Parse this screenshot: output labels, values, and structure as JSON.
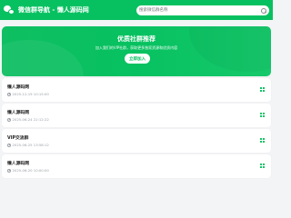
{
  "header": {
    "site_title": "微信群导航 - 懒人源码网",
    "search_placeholder": "搜索微信群名称"
  },
  "banner": {
    "title": "优质社群推荐",
    "description": "加入我们的VIP社群，获取更多独家资源和优质内容",
    "button_label": "立即加入"
  },
  "list": [
    {
      "title": "懒人源码网",
      "time": "2025-12-19 10:15:00"
    },
    {
      "title": "懒人源码网",
      "time": "2025-06-24 22:12:22"
    },
    {
      "title": "VIP交流群",
      "time": "2025-06-25 13:58:12"
    },
    {
      "title": "懒人源码网",
      "time": "2025-06-20 10:00:00"
    }
  ],
  "colors": {
    "primary": "#07c160",
    "background": "#f3f4f6"
  }
}
